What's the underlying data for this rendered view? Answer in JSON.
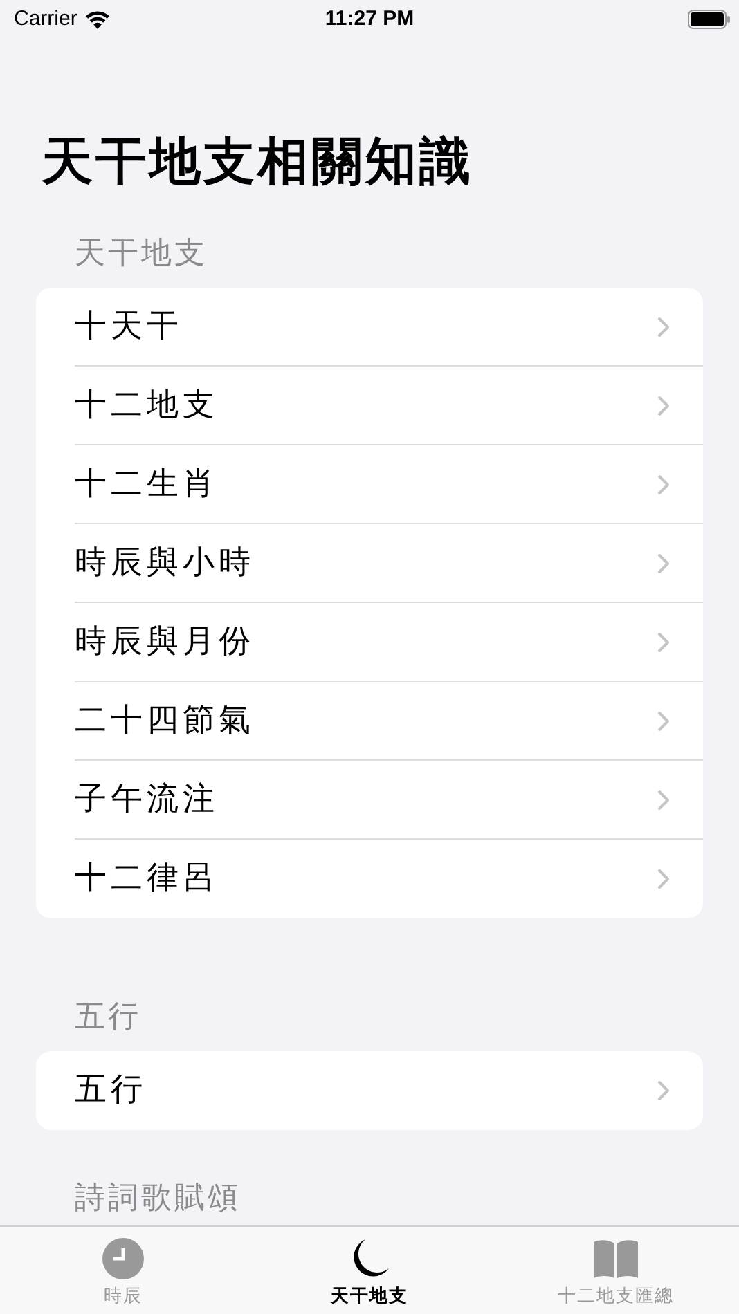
{
  "status_bar": {
    "carrier": "Carrier",
    "time": "11:27 PM"
  },
  "title": "天干地支相關知識",
  "sections": [
    {
      "header": "天干地支",
      "items": [
        "十天干",
        "十二地支",
        "十二生肖",
        "時辰與小時",
        "時辰與月份",
        "二十四節氣",
        "子午流注",
        "十二律呂"
      ]
    },
    {
      "header": "五行",
      "items": [
        "五行"
      ]
    },
    {
      "header": "詩詞歌賦頌"
    }
  ],
  "tabs": [
    {
      "label": "時辰",
      "selected": false
    },
    {
      "label": "天干地支",
      "selected": true
    },
    {
      "label": "十二地支匯總",
      "selected": false
    }
  ]
}
